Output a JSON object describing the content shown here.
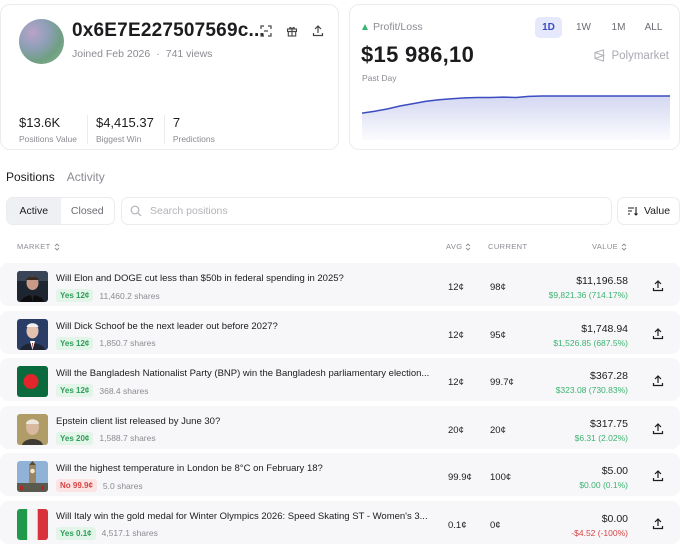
{
  "profile": {
    "address": "0x6E7E227507569c...",
    "joined": "Joined Feb 2026",
    "separator": "·",
    "views": "741 views",
    "icons": [
      "scan-icon",
      "gift-icon",
      "share-icon"
    ],
    "stats": [
      {
        "value": "$13.6K",
        "label": "Positions Value"
      },
      {
        "value": "$4,415.37",
        "label": "Biggest Win"
      },
      {
        "value": "7",
        "label": "Predictions"
      }
    ]
  },
  "pnl": {
    "label": "Profit/Loss",
    "value": "$15 986,10",
    "period": "Past Day",
    "ranges": [
      "1D",
      "1W",
      "1M",
      "ALL"
    ],
    "active_range": "1D",
    "brand": "Polymarket",
    "trend_color": "#3b4cc0",
    "trend": [
      0.55,
      0.6,
      0.66,
      0.74,
      0.8,
      0.86,
      0.9,
      0.93,
      0.95,
      0.96,
      0.96,
      0.97,
      0.96,
      0.99,
      1.0,
      1.0,
      1.0,
      1.0,
      1.0,
      1.0,
      1.0,
      1.0,
      1.0,
      1.0,
      1.0
    ]
  },
  "tabs": [
    "Positions",
    "Activity"
  ],
  "filter": {
    "options": [
      "Active",
      "Closed"
    ],
    "search_placeholder": "Search positions",
    "sort_label": "Value"
  },
  "table": {
    "columns": {
      "market": "MARKET",
      "avg": "AVG",
      "current": "CURRENT",
      "value": "VALUE"
    },
    "rows": [
      {
        "thumb": "elon",
        "title": "Will Elon and DOGE cut less than $50b in federal spending in 2025?",
        "outcome": "Yes 12¢",
        "outcome_type": "yes",
        "shares": "11,460.2 shares",
        "avg": "12¢",
        "current": "98¢",
        "value": "$11,196.58",
        "change": "$9,821.36 (714.17%)",
        "change_type": "pos"
      },
      {
        "thumb": "schoof",
        "title": "Will Dick Schoof be the next leader out before 2027?",
        "outcome": "Yes 12¢",
        "outcome_type": "yes",
        "shares": "1,850.7 shares",
        "avg": "12¢",
        "current": "95¢",
        "value": "$1,748.94",
        "change": "$1,526.85 (687.5%)",
        "change_type": "pos"
      },
      {
        "thumb": "bangladesh",
        "title": "Will the Bangladesh Nationalist Party (BNP) win the Bangladesh parliamentary election...",
        "outcome": "Yes 12¢",
        "outcome_type": "yes",
        "shares": "368.4 shares",
        "avg": "12¢",
        "current": "99.7¢",
        "value": "$367.28",
        "change": "$323.08 (730.83%)",
        "change_type": "pos"
      },
      {
        "thumb": "epstein",
        "title": "Epstein client list released by June 30?",
        "outcome": "Yes 20¢",
        "outcome_type": "yes",
        "shares": "1,588.7 shares",
        "avg": "20¢",
        "current": "20¢",
        "value": "$317.75",
        "change": "$6.31 (2.02%)",
        "change_type": "pos"
      },
      {
        "thumb": "london",
        "title": "Will the highest temperature in London be 8°C on February 18?",
        "outcome": "No 99.9¢",
        "outcome_type": "no",
        "shares": "5.0 shares",
        "avg": "99.9¢",
        "current": "100¢",
        "value": "$5.00",
        "change": "$0.00 (0.1%)",
        "change_type": "zero"
      },
      {
        "thumb": "italy",
        "title": "Will Italy win the gold medal for Winter Olympics 2026: Speed Skating ST - Women's 3...",
        "outcome": "Yes 0.1¢",
        "outcome_type": "yes",
        "shares": "4,517.1 shares",
        "avg": "0.1¢",
        "current": "0¢",
        "value": "$0.00",
        "change": "-$4.52 (-100%)",
        "change_type": "neg"
      }
    ]
  }
}
